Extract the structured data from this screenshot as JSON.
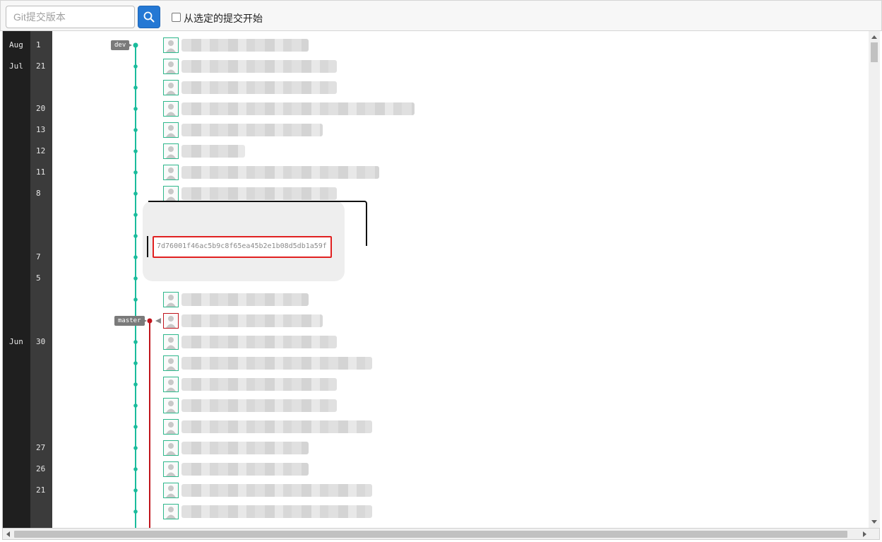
{
  "toolbar": {
    "search_placeholder": "Git提交版本",
    "checkbox_label": "从选定的提交开始"
  },
  "timeline": {
    "months": [
      {
        "label": "Aug",
        "row": 0
      },
      {
        "label": "Jul",
        "row": 1
      },
      {
        "label": "Jun",
        "row": 14
      }
    ],
    "days": [
      {
        "label": "1",
        "row": 0
      },
      {
        "label": "21",
        "row": 1
      },
      {
        "label": "20",
        "row": 3
      },
      {
        "label": "13",
        "row": 4
      },
      {
        "label": "12",
        "row": 5
      },
      {
        "label": "11",
        "row": 6
      },
      {
        "label": "8",
        "row": 7
      },
      {
        "label": "7",
        "row": 10
      },
      {
        "label": "5",
        "row": 11
      },
      {
        "label": "30",
        "row": 14
      },
      {
        "label": "27",
        "row": 19
      },
      {
        "label": "26",
        "row": 20
      },
      {
        "label": "21",
        "row": 21
      }
    ]
  },
  "branches": {
    "dev": "dev",
    "master": "master"
  },
  "tooltip": {
    "commit_hash": "7d76001f46ac5b9c8f65ea45b2e1b08d5db1a59f"
  },
  "colors": {
    "dev_line": "#1abc9c",
    "master_line": "#c0141c",
    "highlight_border": "#e02020"
  }
}
